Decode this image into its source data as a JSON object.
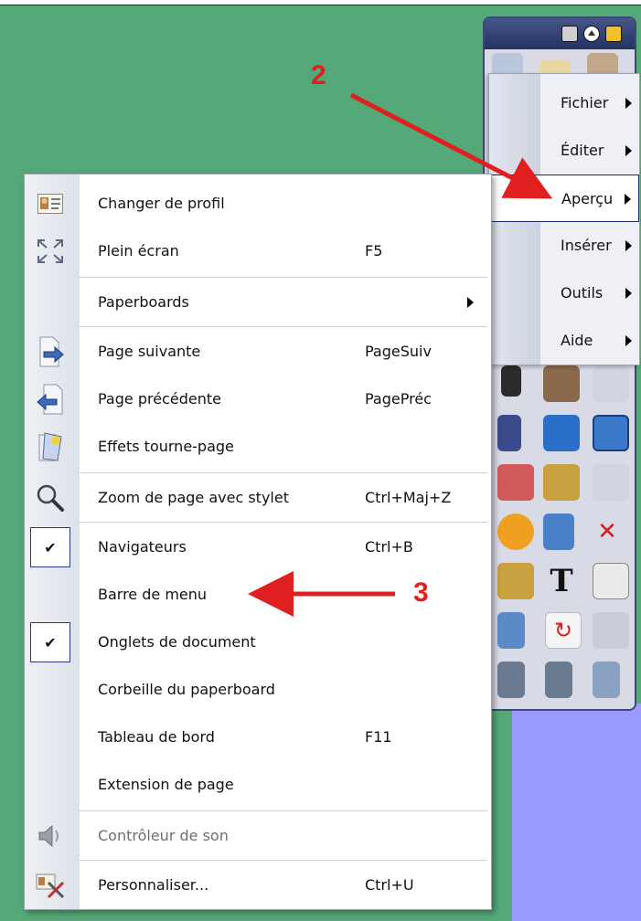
{
  "menubar": {
    "items": [
      {
        "label": "Fichier",
        "selected": false
      },
      {
        "label": "Éditer",
        "selected": false
      },
      {
        "label": "Aperçu",
        "selected": true
      },
      {
        "label": "Insérer",
        "selected": false
      },
      {
        "label": "Outils",
        "selected": false
      },
      {
        "label": "Aide",
        "selected": false
      }
    ]
  },
  "context_menu": {
    "items": [
      {
        "label": "Changer de profil",
        "shortcut": "",
        "icon": "profile-card-icon",
        "checked": false,
        "disabled": false,
        "submenu": false
      },
      {
        "label": "Plein écran",
        "shortcut": "F5",
        "icon": "fullscreen-icon",
        "checked": false,
        "disabled": false,
        "submenu": false
      },
      {
        "label": "Paperboards",
        "shortcut": "",
        "icon": "",
        "checked": false,
        "disabled": false,
        "submenu": true
      },
      {
        "label": "Page suivante",
        "shortcut": "PageSuiv",
        "icon": "next-page-icon",
        "checked": false,
        "disabled": false,
        "submenu": false
      },
      {
        "label": "Page précédente",
        "shortcut": "PagePréc",
        "icon": "previous-page-icon",
        "checked": false,
        "disabled": false,
        "submenu": false
      },
      {
        "label": "Effets tourne-page",
        "shortcut": "",
        "icon": "page-turn-effects-icon",
        "checked": false,
        "disabled": false,
        "submenu": false
      },
      {
        "label": "Zoom de page avec stylet",
        "shortcut": "Ctrl+Maj+Z",
        "icon": "magnifier-icon",
        "checked": false,
        "disabled": false,
        "submenu": false
      },
      {
        "label": "Navigateurs",
        "shortcut": "Ctrl+B",
        "icon": "",
        "checked": true,
        "disabled": false,
        "submenu": false
      },
      {
        "label": "Barre de menu",
        "shortcut": "",
        "icon": "",
        "checked": false,
        "disabled": false,
        "submenu": false
      },
      {
        "label": "Onglets de document",
        "shortcut": "",
        "icon": "",
        "checked": true,
        "disabled": false,
        "submenu": false
      },
      {
        "label": "Corbeille du paperboard",
        "shortcut": "",
        "icon": "",
        "checked": false,
        "disabled": false,
        "submenu": false
      },
      {
        "label": "Tableau de bord",
        "shortcut": "F11",
        "icon": "",
        "checked": false,
        "disabled": false,
        "submenu": false
      },
      {
        "label": "Extension de page",
        "shortcut": "",
        "icon": "",
        "checked": false,
        "disabled": false,
        "submenu": false
      },
      {
        "label": "Contrôleur de son",
        "shortcut": "",
        "icon": "speaker-icon",
        "checked": false,
        "disabled": true,
        "submenu": false
      },
      {
        "label": "Personnaliser...",
        "shortcut": "Ctrl+U",
        "icon": "customize-icon",
        "checked": false,
        "disabled": false,
        "submenu": false
      }
    ],
    "check_glyph": "✔"
  },
  "annotations": {
    "step2": "2",
    "step3": "3"
  },
  "colors": {
    "background": "#55a878",
    "annotation": "#e02020",
    "selection_border": "#1c2d7a"
  }
}
